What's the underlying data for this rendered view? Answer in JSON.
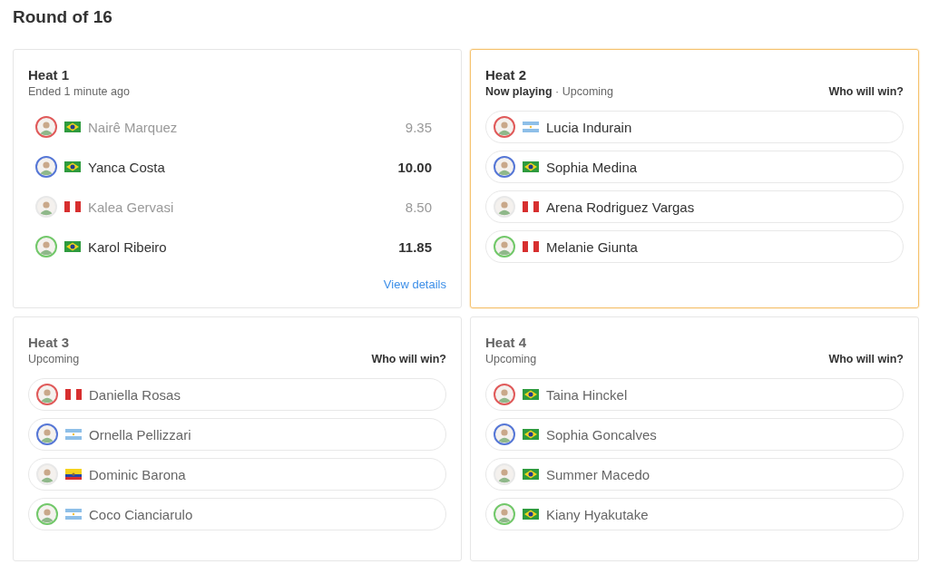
{
  "title": "Round of 16",
  "heats": [
    {
      "title": "Heat 1",
      "kind": "ended",
      "active": false,
      "status": "Ended 1 minute ago",
      "link": "View details",
      "competitors": [
        {
          "name": "Nairê Marquez",
          "kind": "br",
          "color": "#e05a5a",
          "score": "9.35",
          "advanced": false
        },
        {
          "name": "Yanca Costa",
          "kind": "br",
          "color": "#5677d6",
          "score": "10.00",
          "advanced": true
        },
        {
          "name": "Kalea Gervasi",
          "kind": "pe",
          "color": "#e8e8e8",
          "score": "8.50",
          "advanced": false
        },
        {
          "name": "Karol Ribeiro",
          "kind": "br",
          "color": "#72c86a",
          "score": "11.85",
          "advanced": true
        }
      ]
    },
    {
      "title": "Heat 2",
      "kind": "live",
      "active": true,
      "status": "**Now playing** · Upcoming",
      "prompt": "Who will win?",
      "competitors": [
        {
          "name": "Lucia Indurain",
          "kind": "ar",
          "color": "#e05a5a"
        },
        {
          "name": "Sophia Medina",
          "kind": "br",
          "color": "#5677d6"
        },
        {
          "name": "Arena Rodriguez Vargas",
          "kind": "pe",
          "color": "#e8e8e8"
        },
        {
          "name": "Melanie Giunta",
          "kind": "pe",
          "color": "#72c86a"
        }
      ]
    },
    {
      "title": "Heat 3",
      "kind": "upcoming",
      "active": false,
      "status": "Upcoming",
      "prompt": "Who will win?",
      "competitors": [
        {
          "name": "Daniella Rosas",
          "kind": "pe",
          "color": "#e05a5a"
        },
        {
          "name": "Ornella Pellizzari",
          "kind": "ar",
          "color": "#5677d6"
        },
        {
          "name": "Dominic Barona",
          "kind": "ec",
          "color": "#e8e8e8"
        },
        {
          "name": "Coco Cianciarulo",
          "kind": "ar",
          "color": "#72c86a"
        }
      ]
    },
    {
      "title": "Heat 4",
      "kind": "upcoming",
      "active": false,
      "status": "Upcoming",
      "prompt": "Who will win?",
      "competitors": [
        {
          "name": "Taina Hinckel",
          "kind": "br",
          "color": "#e05a5a"
        },
        {
          "name": "Sophia Goncalves",
          "kind": "br",
          "color": "#5677d6"
        },
        {
          "name": "Summer Macedo",
          "kind": "br",
          "color": "#e8e8e8"
        },
        {
          "name": "Kiany Hyakutake",
          "kind": "br",
          "color": "#72c86a"
        }
      ]
    }
  ]
}
